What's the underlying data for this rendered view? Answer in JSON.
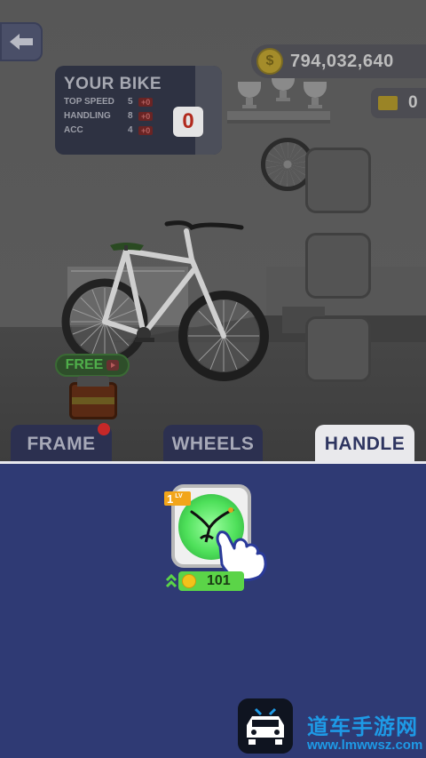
{
  "hud": {
    "coins": "794,032,640",
    "gems": "0"
  },
  "bike_panel": {
    "title": "YOUR BIKE",
    "stats": [
      {
        "name": "TOP SPEED",
        "value": "5",
        "bonus": "+0"
      },
      {
        "name": "HANDLING",
        "value": "8",
        "bonus": "+0"
      },
      {
        "name": "ACC",
        "value": "4",
        "bonus": "+0"
      }
    ],
    "score": "0"
  },
  "free_button": {
    "label": "FREE"
  },
  "tabs": {
    "frame": "FRAME",
    "wheels": "WHEELS",
    "handle": "HANDLE",
    "selected": "HANDLE"
  },
  "item": {
    "level": "1",
    "level_suffix": "LV",
    "price": "101"
  },
  "watermark": {
    "title": "道车手游网",
    "url": "www.lmwwsz.com"
  },
  "colors": {
    "bottom_panel": "#2f3a74",
    "price_pill": "#5bd448",
    "level_tag": "#f2a51a",
    "tab_selected": "#e9e9ec",
    "score_text": "#b12a1d"
  },
  "icons": [
    "back-arrow-icon",
    "coin-icon",
    "gem-icon",
    "trophy-icon",
    "play-icon",
    "chest-icon",
    "handlebar-icon",
    "pointer-hand-icon",
    "upgrade-arrows-icon",
    "brand-logo-icon"
  ]
}
